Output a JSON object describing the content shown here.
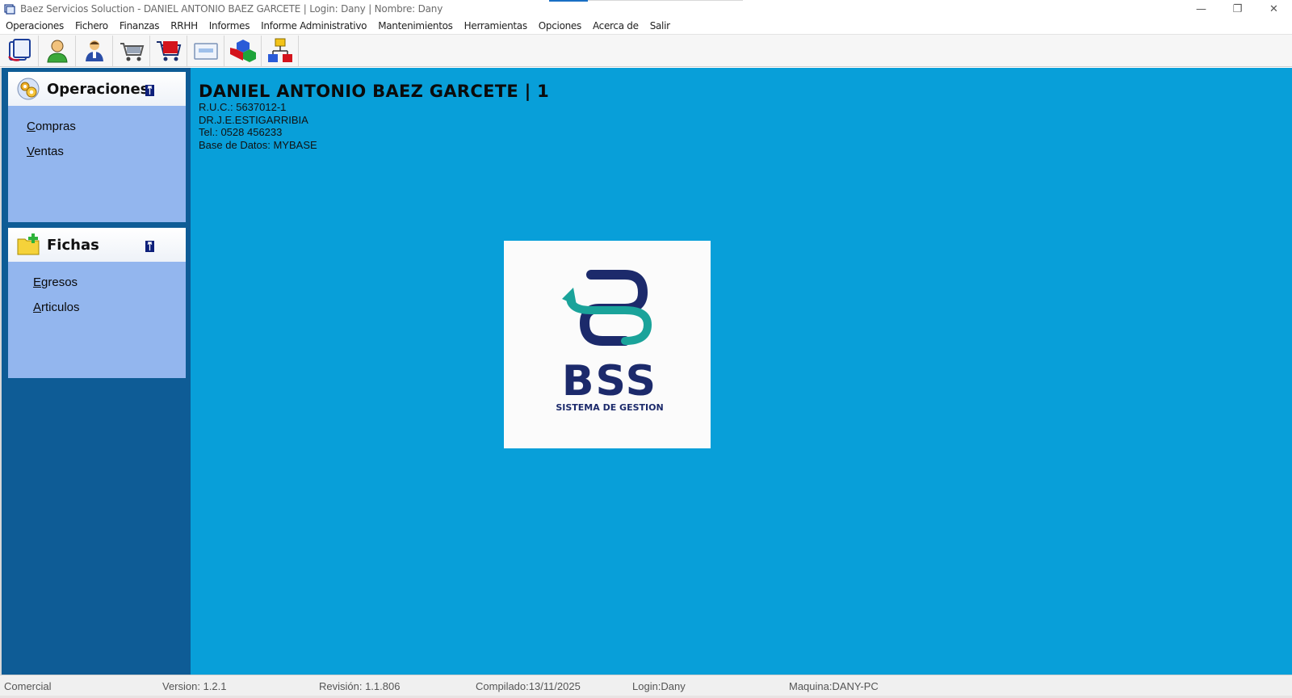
{
  "window": {
    "title": "Baez Servicios Soluction - DANIEL ANTONIO BAEZ GARCETE  | Login: Dany  | Nombre: Dany",
    "controls": {
      "minimize": "—",
      "restore": "❐",
      "close": "✕"
    }
  },
  "menu": [
    {
      "label": "Operaciones"
    },
    {
      "label": "Fichero"
    },
    {
      "label": "Finanzas"
    },
    {
      "label": "RRHH"
    },
    {
      "label": "Informes"
    },
    {
      "label": "Informe Administrativo"
    },
    {
      "label": "Mantenimientos"
    },
    {
      "label": "Herramientas"
    },
    {
      "label": "Opciones"
    },
    {
      "label": "Acerca de"
    },
    {
      "label": "Salir"
    }
  ],
  "toolbar": {
    "buttons": [
      {
        "icon": "documents-icon"
      },
      {
        "icon": "user-icon"
      },
      {
        "icon": "employee-icon"
      },
      {
        "icon": "cash-register-icon"
      },
      {
        "icon": "shopping-cart-icon"
      },
      {
        "icon": "card-icon"
      },
      {
        "icon": "cubes-icon"
      },
      {
        "icon": "hierarchy-icon"
      }
    ]
  },
  "sidebar": {
    "panels": [
      {
        "title": "Operaciones",
        "icon": "gears-icon",
        "links": [
          {
            "underline": "C",
            "rest": "ompras"
          },
          {
            "underline": "V",
            "rest": "entas"
          }
        ]
      },
      {
        "title": "Fichas",
        "icon": "folder-add-icon",
        "links": [
          {
            "underline": "E",
            "rest": "gresos"
          },
          {
            "underline": "A",
            "rest": "rticulos"
          }
        ]
      }
    ]
  },
  "company": {
    "name": "DANIEL ANTONIO BAEZ GARCETE | 1",
    "ruc": "R.U.C.: 5637012-1",
    "address": "DR.J.E.ESTIGARRIBIA",
    "phone": "Tel.: 0528 456233",
    "database": "Base de Datos: MYBASE"
  },
  "logo": {
    "letters": "BSS",
    "tagline": "SISTEMA DE GESTION"
  },
  "status": {
    "module": "Comercial",
    "version": "Version:  1.2.1",
    "revision": "Revisión:  1.1.806",
    "compiled": "Compilado:13/11/2025",
    "login": "Login:Dany",
    "machine": "Maquina:DANY-PC"
  },
  "colors": {
    "main_bg": "#089fd9",
    "sidebar_bg": "#0e5c96",
    "panel_bg": "#93b6ee",
    "logo_navy": "#1c2a6b",
    "logo_teal": "#1aa39a"
  }
}
